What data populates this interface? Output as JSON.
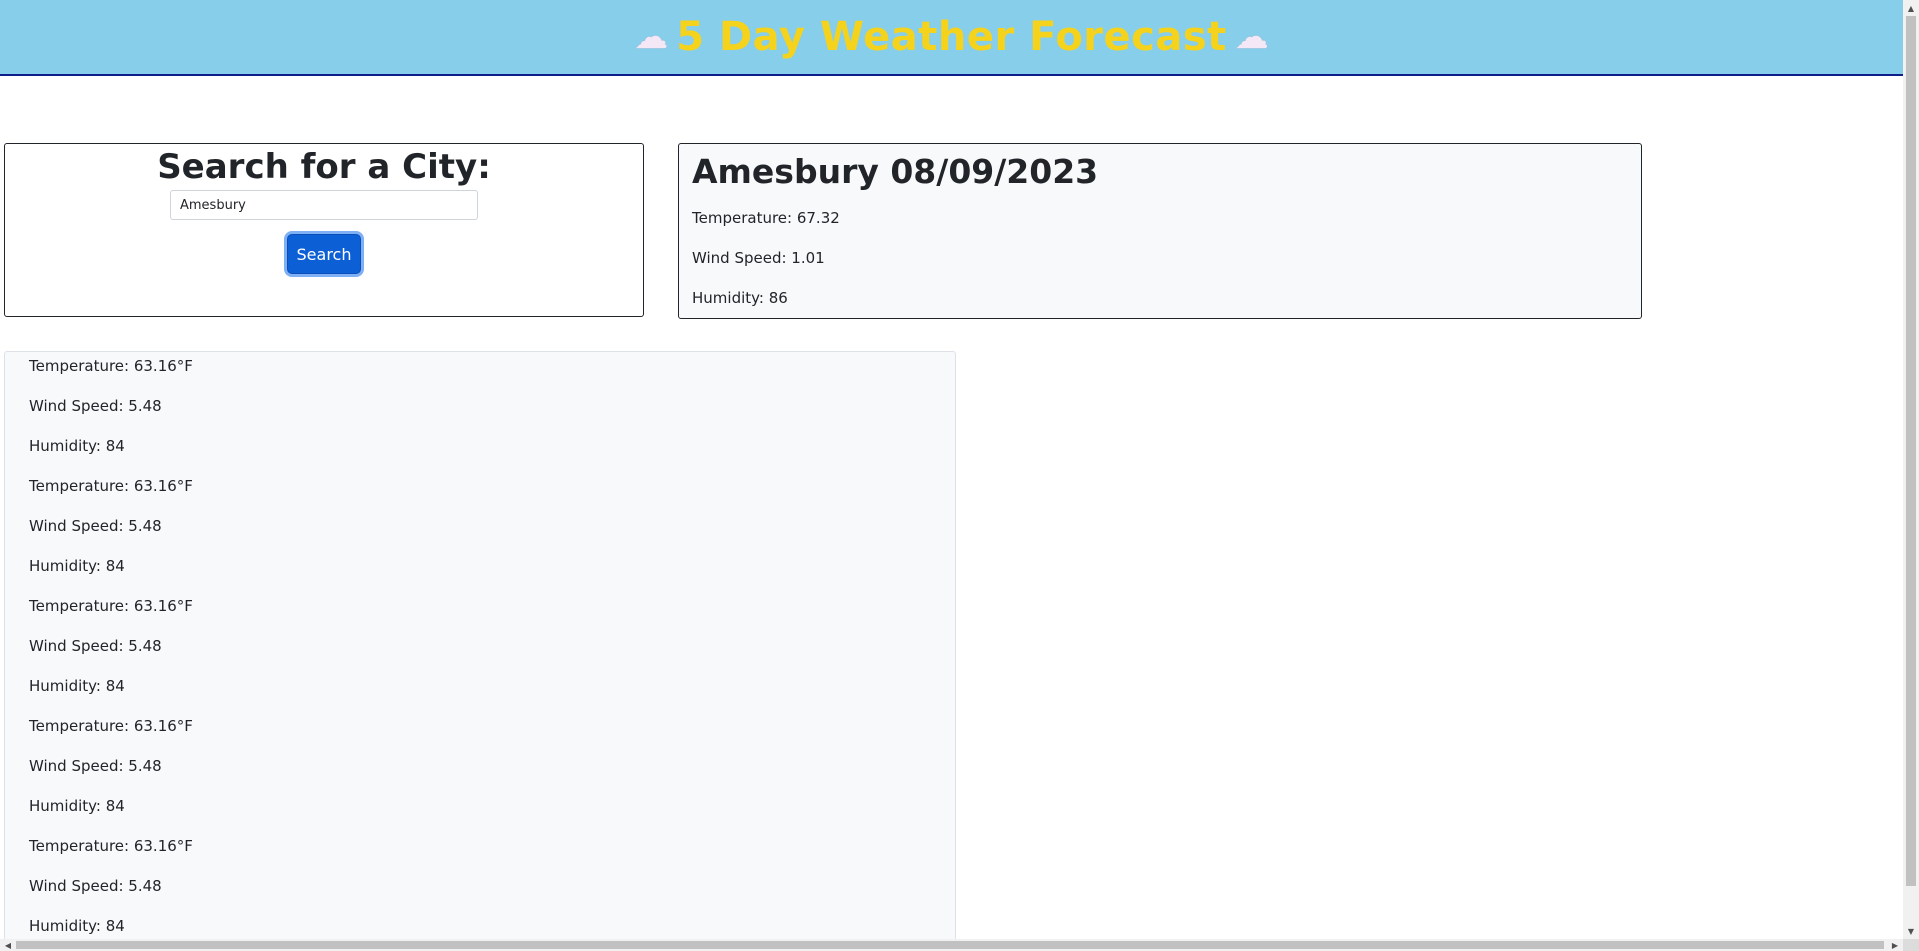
{
  "header": {
    "title": "5 Day Weather Forecast",
    "left_icon": "cloud-icon",
    "right_icon": "cloud-icon",
    "left_icon_glyph": "☁",
    "right_icon_glyph": "☁",
    "background_color": "#87ceeb",
    "title_color": "#f5d21c"
  },
  "search": {
    "heading": "Search for a City:",
    "input_value": "Amesbury",
    "button_label": "Search",
    "button_color": "#0d5fd6"
  },
  "current": {
    "heading": "Amesbury 08/09/2023",
    "temperature": "Temperature: 67.32",
    "wind": "Wind Speed: 1.01",
    "humidity": "Humidity: 86"
  },
  "forecast": [
    {
      "temperature": "Temperature: 63.16°F",
      "wind": "Wind Speed: 5.48",
      "humidity": "Humidity: 84"
    },
    {
      "temperature": "Temperature: 63.16°F",
      "wind": "Wind Speed: 5.48",
      "humidity": "Humidity: 84"
    },
    {
      "temperature": "Temperature: 63.16°F",
      "wind": "Wind Speed: 5.48",
      "humidity": "Humidity: 84"
    },
    {
      "temperature": "Temperature: 63.16°F",
      "wind": "Wind Speed: 5.48",
      "humidity": "Humidity: 84"
    },
    {
      "temperature": "Temperature: 63.16°F",
      "wind": "Wind Speed: 5.48",
      "humidity": "Humidity: 84"
    }
  ],
  "scrollbars": {
    "up_arrow": "▲",
    "down_arrow": "▼",
    "left_arrow": "◀",
    "right_arrow": "▶"
  }
}
